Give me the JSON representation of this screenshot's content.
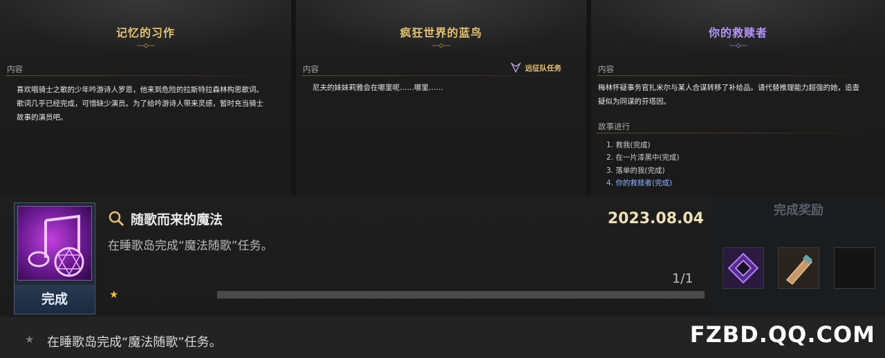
{
  "cards": [
    {
      "title": "记忆的习作",
      "section_label": "内容",
      "description": "喜欢唱骑士之歌的少年吟游诗人罗恩，他来到危险的拉斯特拉森林构思歌词。歌词几乎已经完成，可惜缺少演员。为了给吟游诗人带来灵感，暂时充当骑士故事的演员吧。"
    },
    {
      "title": "疯狂世界的蓝鸟",
      "section_label": "内容",
      "badge": "远征队任务",
      "description": "尼夫的妹妹莉雅会在哪里呢……哪里……"
    },
    {
      "title": "你的救赎者",
      "section_label": "内容",
      "description": "梅林怀疑事务官扎米尔与某人合谋转移了补给品。请代替推理能力超强的她，追查疑似为同谋的芬塔因。",
      "story_label": "故事进行",
      "steps": [
        "1. 救我(完成)",
        "2. 在一片漆黑中(完成)",
        "3. 落单的我(完成)",
        "4. 你的救赎者(完成)"
      ]
    }
  ],
  "achievement": {
    "name": "随歌而来的魔法",
    "description": "在睡歌岛完成“魔法随歌”任务。",
    "date": "2023.08.04",
    "status": "完成",
    "progress_text": "1/1",
    "progress_fraction": 1.0,
    "reward_title": "完成奖励"
  },
  "condition": {
    "text": "在睡歌岛完成“魔法随歌”任务。"
  },
  "watermark": "FZBD.QQ.COM",
  "colors": {
    "gold": "#e6c276",
    "purple": "#b496ff",
    "current_step": "#8fb5ff"
  }
}
